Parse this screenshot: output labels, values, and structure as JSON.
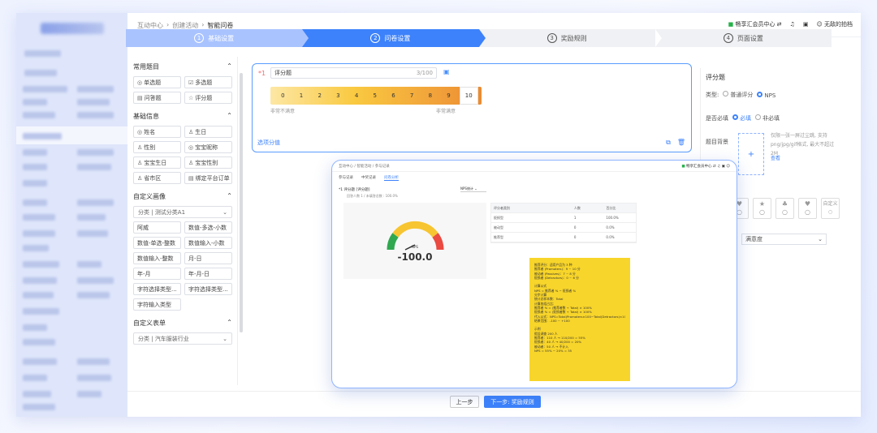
{
  "breadcrumb": [
    "互动中心",
    "创建活动",
    "智能问卷"
  ],
  "topbar": {
    "vip": "畅享汇会员中心",
    "user": "无敌的拍档"
  },
  "steps": [
    {
      "num": "1",
      "label": "基础设置",
      "state": "done"
    },
    {
      "num": "2",
      "label": "问卷设置",
      "state": "active"
    },
    {
      "num": "3",
      "label": "奖励规则",
      "state": "plain"
    },
    {
      "num": "4",
      "label": "页面设置",
      "state": "plain"
    }
  ],
  "palette": {
    "common": {
      "title": "常用题目",
      "items": [
        "单选题",
        "多选题",
        "问答题",
        "评分题"
      ],
      "icons": [
        "◎",
        "☑",
        "▤",
        "☆"
      ]
    },
    "basic": {
      "title": "基础信息",
      "items": [
        "姓名",
        "生日",
        "性别",
        "宝宝昵称",
        "宝宝生日",
        "宝宝性别",
        "省市区",
        "绑定平台订单"
      ],
      "icons": [
        "◎",
        "♙",
        "♙",
        "◎",
        "♙",
        "♙",
        "♙",
        "▤"
      ]
    },
    "custom_img": {
      "title": "自定义画像",
      "select_label": "分类",
      "select_value": "测试分类A1",
      "items": [
        "阿威",
        "数值-多选-小数",
        "数值-单选-整数",
        "数值输入-小数",
        "数值输入-整数",
        "月-日",
        "年-月",
        "年-月-日",
        "字符选择类型...",
        "字符选择类型...",
        "字符输入类型"
      ]
    },
    "custom_tag": {
      "title": "自定义表单",
      "select_label": "分类",
      "select_value": "汽车服装行业"
    }
  },
  "question": {
    "num": "1",
    "title": "评分题",
    "counter": "3/100",
    "scale": [
      "0",
      "1",
      "2",
      "3",
      "4",
      "5",
      "6",
      "7",
      "8",
      "9",
      "10"
    ],
    "low_label": "非常不满意",
    "high_label": "非常满意",
    "option_link": "选项分值"
  },
  "props": {
    "title": "评分题",
    "type_label": "类型:",
    "type_opts": [
      "普通评分",
      "NPS"
    ],
    "required_label": "是否必填",
    "required_opts": [
      "必填",
      "非必填"
    ],
    "bg_label": "题目背景",
    "upload_hint": "仅限一张一屏过尘跳, 支持png/jpg/gif格式, 最大不超过2M",
    "upload_link": "查看",
    "icon_last": "自定义",
    "select_value": "满意度"
  },
  "footer": {
    "prev": "上一步",
    "next": "下一步: 奖励规则"
  },
  "popup": {
    "crumb": "互动中心 / 智能活动 / 参与记录",
    "top_right": "畅享汇会员中心",
    "tabs": [
      "参与记录",
      "中奖记录",
      "问卷分析"
    ],
    "question": "评分题 [评分题]",
    "question_sub": "回答人数 1 / 未填答总数 : 100.0%",
    "nps_select": "NPS统计",
    "gauge_value": "-100.0",
    "gauge_caption": "NPS",
    "table": {
      "headers": [
        "评分者类别",
        "人数",
        "百分比"
      ],
      "rows": [
        [
          "贬损型",
          "1",
          "100.0%"
        ],
        [
          "被动型",
          "0",
          "0.0%"
        ],
        [
          "推荐型",
          "0",
          "0.0%"
        ]
      ]
    },
    "note": [
      "推荐评分：适用产品为 3 种",
      "推荐者 (Promoters)：9 ~ 10 分",
      "被动者 (Passives)：7 ~ 8 分",
      "贬损者 (Detractors)：0 ~ 6 分",
      "",
      "计算公式",
      "NPS = 推荐者 % − 贬损者 %",
      "分步计算",
      "统计总样本数：Total",
      "计算各组占比：",
      "推荐者 % = (推荐者数 ÷ Total) × 100%",
      "贬损者 % = (贬损者数 ÷ Total) × 100%",
      "代入公式：NPS=Total(Promoters×100−Total(Detractors)×100",
      "结果范围：-100 ~ +100",
      "",
      "示例",
      "假设调查 200 人",
      "推荐者：110 人 → 110/200 = 55%",
      "贬损者：40 人 → 40/200 = 20%",
      "被动者：50 人 → 不计入",
      "NPS = 55% − 20% = 35"
    ]
  }
}
